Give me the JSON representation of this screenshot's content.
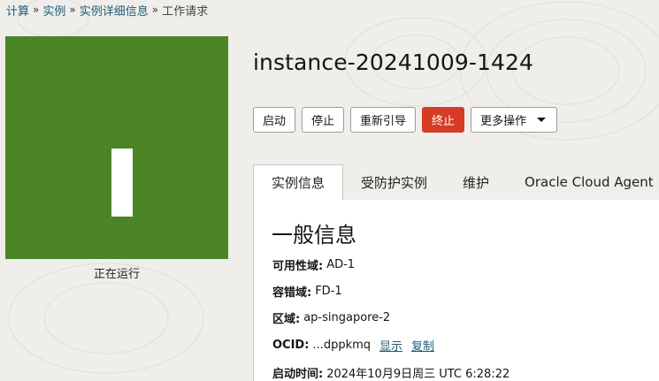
{
  "breadcrumb": {
    "items": [
      "计算",
      "实例",
      "实例详细信息"
    ],
    "current": "工作请求"
  },
  "instance": {
    "name": "instance-20241009-1424",
    "status": "正在运行",
    "status_color": "#4c8525"
  },
  "actions": {
    "start": "启动",
    "stop": "停止",
    "reboot": "重新引导",
    "terminate": "终止",
    "more": "更多操作"
  },
  "tabs": [
    "实例信息",
    "受防护实例",
    "维护",
    "Oracle Cloud Agent"
  ],
  "active_tab": 0,
  "general_info": {
    "title": "一般信息",
    "availability_domain": {
      "label": "可用性域:",
      "value": "AD-1"
    },
    "fault_domain": {
      "label": "容错域:",
      "value": "FD-1"
    },
    "region": {
      "label": "区域:",
      "value": "ap-singapore-2"
    },
    "ocid": {
      "label": "OCID:",
      "value": "...dppkmq",
      "show": "显示",
      "copy": "复制"
    },
    "launched": {
      "label": "启动时间:",
      "value": "2024年10月9日周三 UTC 6:28:22"
    }
  },
  "colors": {
    "accent_link": "#1f5b7a",
    "danger": "#d63b25",
    "page_bg": "#efeeeb"
  }
}
